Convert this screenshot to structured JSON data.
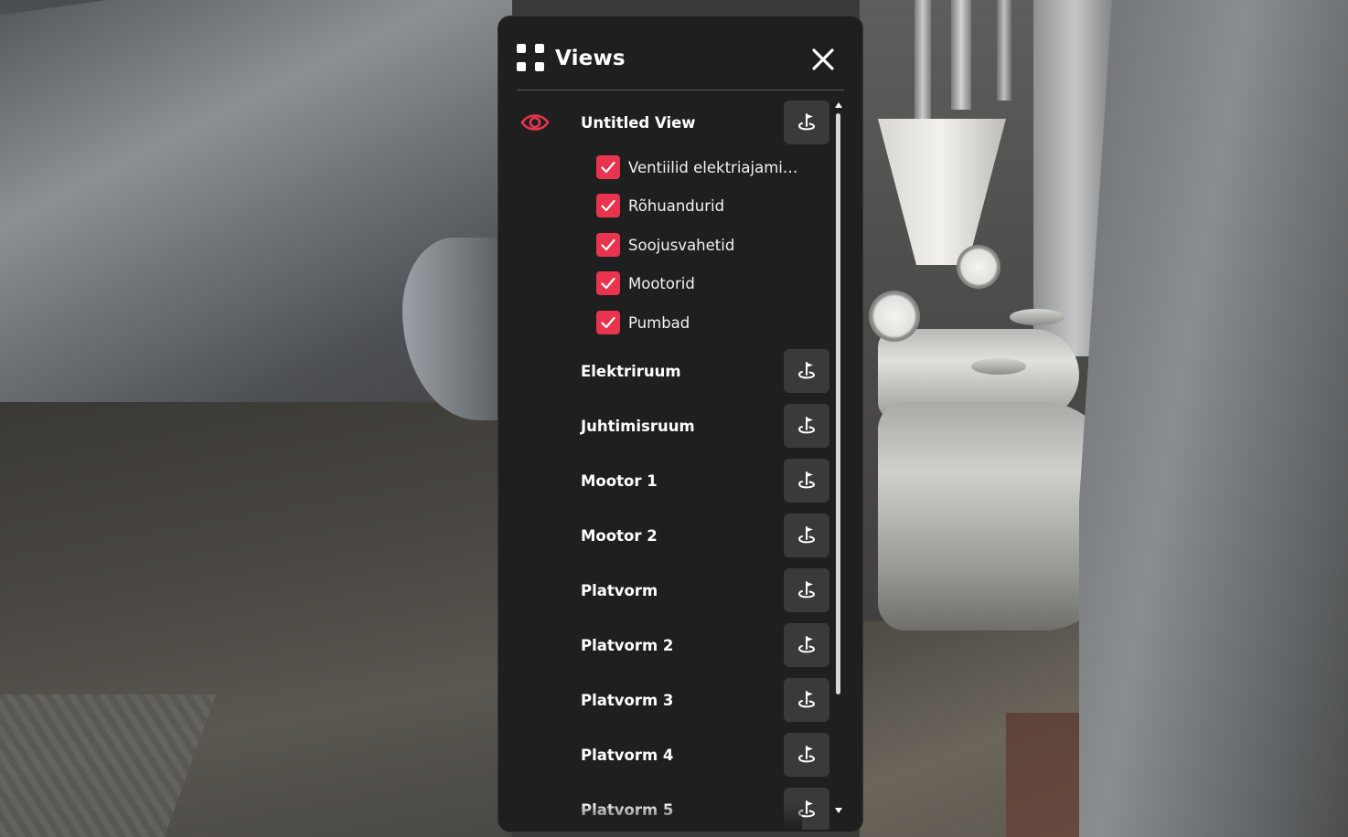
{
  "panel": {
    "title": "Views",
    "close_label": "",
    "icon": "grid-icon"
  },
  "active_view": {
    "label": "Untitled View",
    "icon": "eye-icon",
    "accent": "#e8344e",
    "layers": [
      {
        "label": "Ventiilid elektriajami…",
        "checked": true
      },
      {
        "label": "Rõhuandurid",
        "checked": true
      },
      {
        "label": "Soojusvahetid",
        "checked": true
      },
      {
        "label": "Mootorid",
        "checked": true
      },
      {
        "label": "Pumbad",
        "checked": true
      }
    ]
  },
  "views": [
    {
      "label": "Elektriruum"
    },
    {
      "label": "Juhtimisruum"
    },
    {
      "label": "Mootor 1"
    },
    {
      "label": "Mootor 2"
    },
    {
      "label": "Platvorm"
    },
    {
      "label": "Platvorm 2"
    },
    {
      "label": "Platvorm 3"
    },
    {
      "label": "Platvorm 4"
    },
    {
      "label": "Platvorm 5"
    }
  ],
  "action_icon": "goto-view-icon",
  "colors": {
    "panel_bg": "#1f1f1f",
    "button_bg": "#3a3a3a",
    "accent": "#e8344e",
    "text": "#ffffff"
  }
}
